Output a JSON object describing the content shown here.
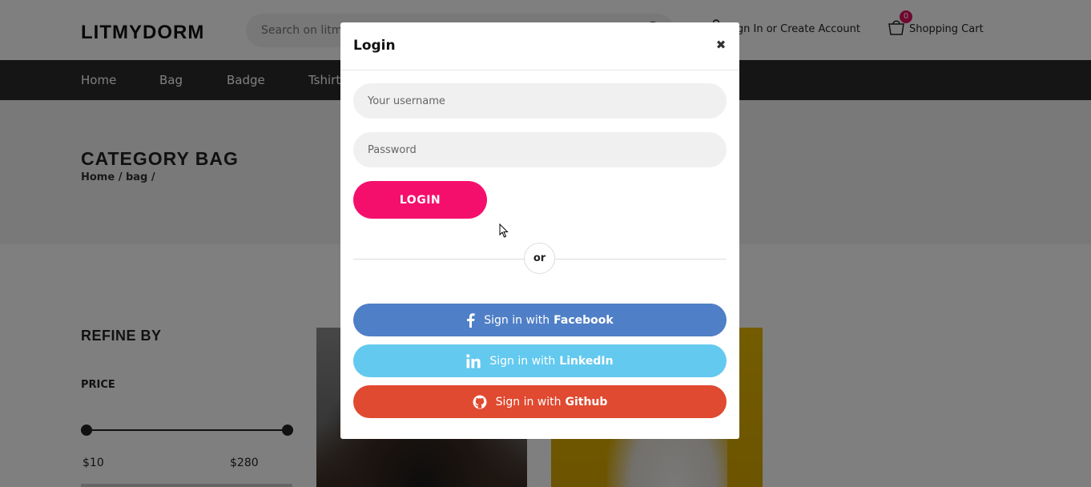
{
  "header": {
    "logo": "LITMYDORM",
    "search_placeholder": "Search on litmydorm",
    "account_text": "Sign In or Create Account",
    "cart_count": "0",
    "cart_label": "Shopping Cart"
  },
  "nav": {
    "items": [
      "Home",
      "Bag",
      "Badge",
      "Tshirt"
    ]
  },
  "banner": {
    "title": "CATEGORY BAG",
    "breadcrumb": "Home / bag /"
  },
  "sidebar": {
    "refine_title": "REFINE BY",
    "price_label": "PRICE",
    "price_min": "$10",
    "price_max": "$280"
  },
  "modal": {
    "title": "Login",
    "close_glyph": "✖",
    "username_placeholder": "Your username",
    "password_placeholder": "Password",
    "login_label": "LOGIN",
    "or_label": "or",
    "facebook": {
      "prefix": "Sign in with",
      "brand": "Facebook",
      "color": "#4f7fc6",
      "icon": "facebook-icon"
    },
    "linkedin": {
      "prefix": "Sign in with",
      "brand": "LinkedIn",
      "color": "#63c9ef",
      "icon": "linkedin-icon"
    },
    "github": {
      "prefix": "Sign in with",
      "brand": "Github",
      "color": "#e04a30",
      "icon": "github-icon"
    }
  },
  "colors": {
    "accent": "#f50f6d",
    "nav_bg": "#2a2a2a",
    "badge": "#e0115f"
  }
}
